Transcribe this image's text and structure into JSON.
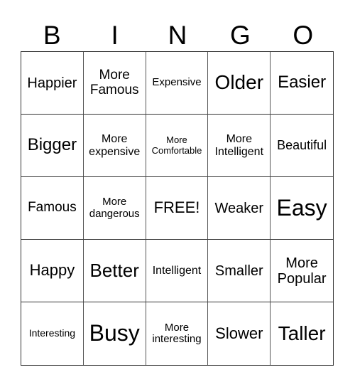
{
  "header": {
    "letters": [
      "B",
      "I",
      "N",
      "G",
      "O"
    ]
  },
  "card": {
    "rows": [
      [
        "Happier",
        "More Famous",
        "Expensive",
        "Older",
        "Easier"
      ],
      [
        "Bigger",
        "More expensive",
        "More Comfortable",
        "More Intelligent",
        "Beautiful"
      ],
      [
        "Famous",
        "More dangerous",
        "FREE!",
        "Weaker",
        "Easy"
      ],
      [
        "Happy",
        "Better",
        "Intelligent",
        "Smaller",
        "More Popular"
      ],
      [
        "Interesting",
        "Busy",
        "More interesting",
        "Slower",
        "Taller"
      ]
    ]
  }
}
